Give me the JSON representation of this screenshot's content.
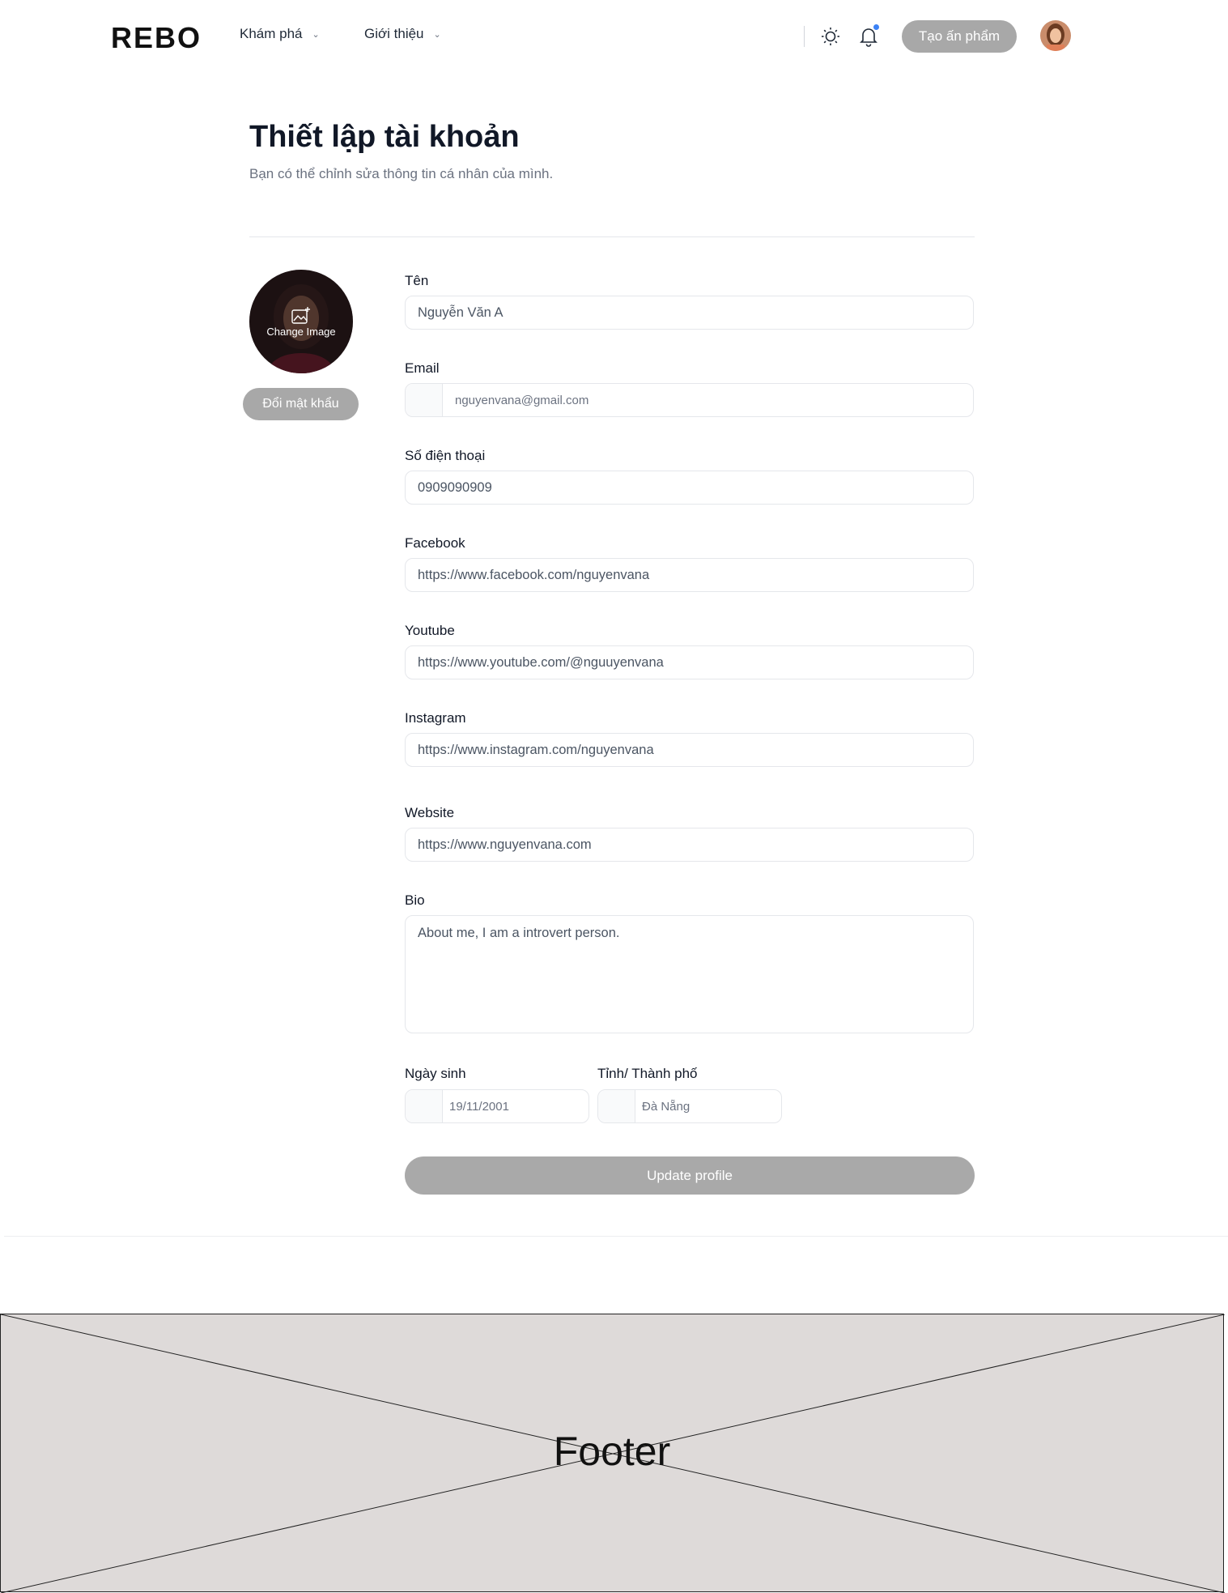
{
  "header": {
    "logo": "REBO",
    "nav": [
      {
        "label": "Khám phá"
      },
      {
        "label": "Giới thiệu"
      }
    ],
    "create_button": "Tạo ấn phẩm"
  },
  "page": {
    "title": "Thiết lập tài khoản",
    "subtitle": "Bạn có thể chỉnh sửa thông tin cá nhân của mình."
  },
  "profile": {
    "change_image_label": "Change Image",
    "change_password_button": "Đổi mật khẩu"
  },
  "form": {
    "name": {
      "label": "Tên",
      "value": "Nguyễn Văn A"
    },
    "email": {
      "label": "Email",
      "value": "nguyenvana@gmail.com"
    },
    "phone": {
      "label": "Số điện thoại",
      "value": "0909090909"
    },
    "facebook": {
      "label": "Facebook",
      "value": "https://www.facebook.com/nguyenvana"
    },
    "youtube": {
      "label": "Youtube",
      "value": "https://www.youtube.com/@nguuyenvana"
    },
    "instagram": {
      "label": "Instagram",
      "value": "https://www.instagram.com/nguyenvana"
    },
    "website": {
      "label": "Website",
      "value": "https://www.nguyenvana.com"
    },
    "bio": {
      "label": "Bio",
      "value": "About me, I am a introvert person."
    },
    "birthday": {
      "label": "Ngày sinh",
      "value": "19/11/2001"
    },
    "city": {
      "label": "Tỉnh/ Thành phố",
      "value": "Đà Nẵng"
    },
    "submit": "Update profile"
  },
  "footer": {
    "label": "Footer"
  },
  "colors": {
    "button_gray": "#a8a8a8",
    "notification_dot": "#3b82f6",
    "footer_bg": "#dedad9"
  }
}
